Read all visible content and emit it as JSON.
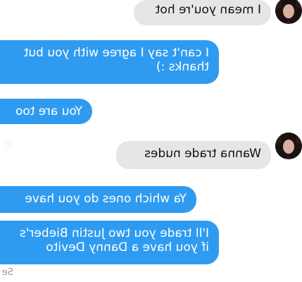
{
  "messages": [
    {
      "id": "m1",
      "sender": "them",
      "text_lines": [
        "I mean you're hot"
      ]
    },
    {
      "id": "m2",
      "sender": "me",
      "text_lines": [
        "I can't say I agree with you but",
        "thanks :)"
      ]
    },
    {
      "id": "m3",
      "sender": "me",
      "text_lines": [
        "You are too"
      ]
    },
    {
      "id": "m4",
      "sender": "them",
      "text_lines": [
        "Wanna trade nudes"
      ]
    },
    {
      "id": "m5",
      "sender": "me",
      "text_lines": [
        "Ya which ones do you have"
      ]
    },
    {
      "id": "m6",
      "sender": "me",
      "text_lines": [
        "I'll trade you two Justin Bieber's",
        "if you have a Danny Devito"
      ]
    }
  ],
  "status": {
    "seen_label": "Se"
  },
  "colors": {
    "outgoing_bubble": "#2f9bf0",
    "incoming_bubble": "#e6e6e8",
    "outgoing_text": "#ffffff",
    "incoming_text": "#111111"
  },
  "icons": {
    "like": "heart-icon"
  }
}
